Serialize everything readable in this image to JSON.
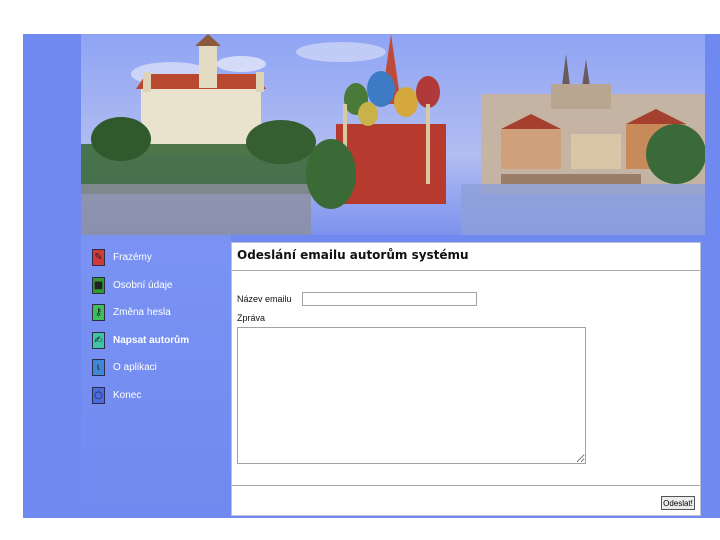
{
  "page": {
    "title": "Odeslání emailu autorům systému"
  },
  "sidebar": {
    "items": [
      {
        "label": "Frazémy",
        "icon": "phrase-book-icon",
        "color": "#d23a3a",
        "active": false
      },
      {
        "label": "Osobní údaje",
        "icon": "person-card-icon",
        "color": "#2f9a2f",
        "active": false
      },
      {
        "label": "Změna hesla",
        "icon": "key-icon",
        "color": "#3fbf5a",
        "active": false
      },
      {
        "label": "Napsat autorům",
        "icon": "pen-icon",
        "color": "#41c3a7",
        "active": true
      },
      {
        "label": "O aplikaci",
        "icon": "info-icon",
        "color": "#3f86d6",
        "active": false
      },
      {
        "label": "Konec",
        "icon": "exit-icon",
        "color": "#4a6ae0",
        "active": false
      }
    ]
  },
  "form": {
    "name_label": "Název emailu",
    "name_value": "",
    "message_label": "Zpráva",
    "message_value": "",
    "send_label": "Odeslat!"
  },
  "colors": {
    "frame": "#6f89f0",
    "banner_sky": "#9fb0f0"
  }
}
